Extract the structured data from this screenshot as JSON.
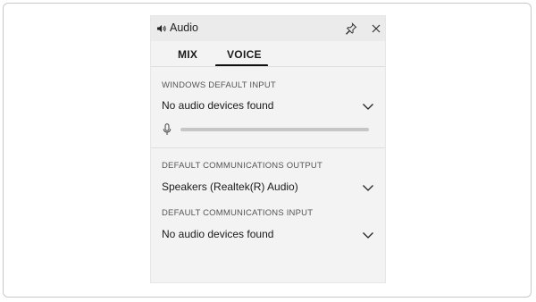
{
  "window": {
    "title": "Audio",
    "title_icon": "speaker-icon",
    "pin_icon": "pin-icon",
    "close_icon": "close-icon"
  },
  "tabs": [
    {
      "label": "MIX",
      "selected": false
    },
    {
      "label": "VOICE",
      "selected": true
    }
  ],
  "voice": {
    "input_section_label": "WINDOWS DEFAULT INPUT",
    "input_device": "No audio devices found",
    "input_level": 0,
    "comm_output_label": "DEFAULT COMMUNICATIONS OUTPUT",
    "comm_output_device": "Speakers (Realtek(R) Audio)",
    "comm_input_label": "DEFAULT COMMUNICATIONS INPUT",
    "comm_input_device": "No audio devices found"
  },
  "colors": {
    "panel_bg": "#f3f3f3",
    "titlebar_bg": "#ebebeb",
    "active_tab_indicator": "#111111",
    "level_track": "#c6c6c6"
  }
}
